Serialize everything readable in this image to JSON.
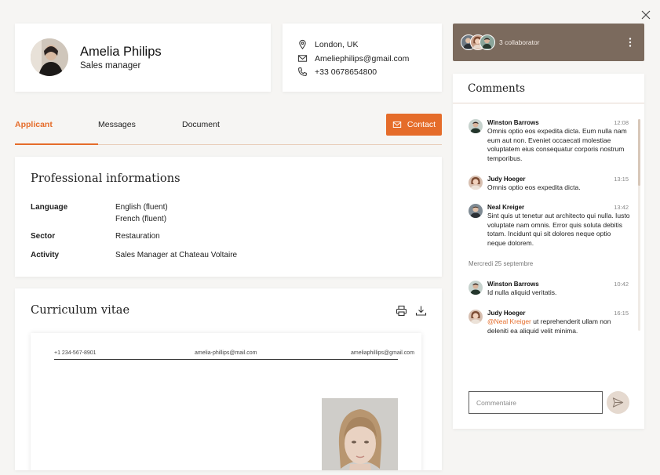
{
  "profile": {
    "name": "Amelia Philips",
    "role": "Sales manager"
  },
  "contact": {
    "location": "London, UK",
    "email": "Ameliephilips@gmail.com",
    "phone": "+33 0678654800"
  },
  "tabs": [
    {
      "label": "Applicant",
      "active": true
    },
    {
      "label": "Messages",
      "active": false
    },
    {
      "label": "Document",
      "active": false
    }
  ],
  "contact_button": "Contact",
  "professional": {
    "title": "Professional informations",
    "language_label": "Language",
    "languages": [
      "English (fluent)",
      "French (fluent)"
    ],
    "sector_label": "Sector",
    "sector": "Restauration",
    "activity_label": "Activity",
    "activity": "Sales Manager at Chateau Voltaire"
  },
  "cv": {
    "title": "Curriculum vitae",
    "phone": "+1 234-567-8901",
    "email1": "amelia-phillips@mail.com",
    "email2": "ameliaphillips@gmail.com"
  },
  "collaborators": {
    "label": "3 collaborator"
  },
  "comments": {
    "title": "Comments",
    "items": [
      {
        "name": "Winston Barrows",
        "time": "12:08",
        "text": "Omnis optio eos expedita dicta. Eum nulla nam eum aut non. Eveniet occaecati molestiae voluptatem eius consequatur corporis nostrum temporibus."
      },
      {
        "name": "Judy Hoeger",
        "time": "13:15",
        "text": "Omnis optio eos expedita dicta."
      },
      {
        "name": "Neal Kreiger",
        "time": "13:42",
        "text": "Sint quis ut tenetur aut architecto qui nulla. Iusto voluptate nam omnis. Error quis soluta debitis totam. Incidunt qui sit dolores neque optio neque dolorem."
      },
      {
        "name": "Winston Barrows",
        "time": "10:42",
        "text": "Id nulla aliquid veritatis."
      },
      {
        "name": "Judy Hoeger",
        "time": "16:15",
        "mention": "@Neal Kreiger",
        "text": " ut reprehenderit ullam non deleniti ea aliquid velit minima."
      }
    ],
    "day_separator": "Mercredi 25 septembre",
    "input_placeholder": "Commentaire"
  },
  "colors": {
    "accent": "#e56c2a",
    "collab_bg": "#7b6a5d",
    "background": "#f6f5f3"
  }
}
